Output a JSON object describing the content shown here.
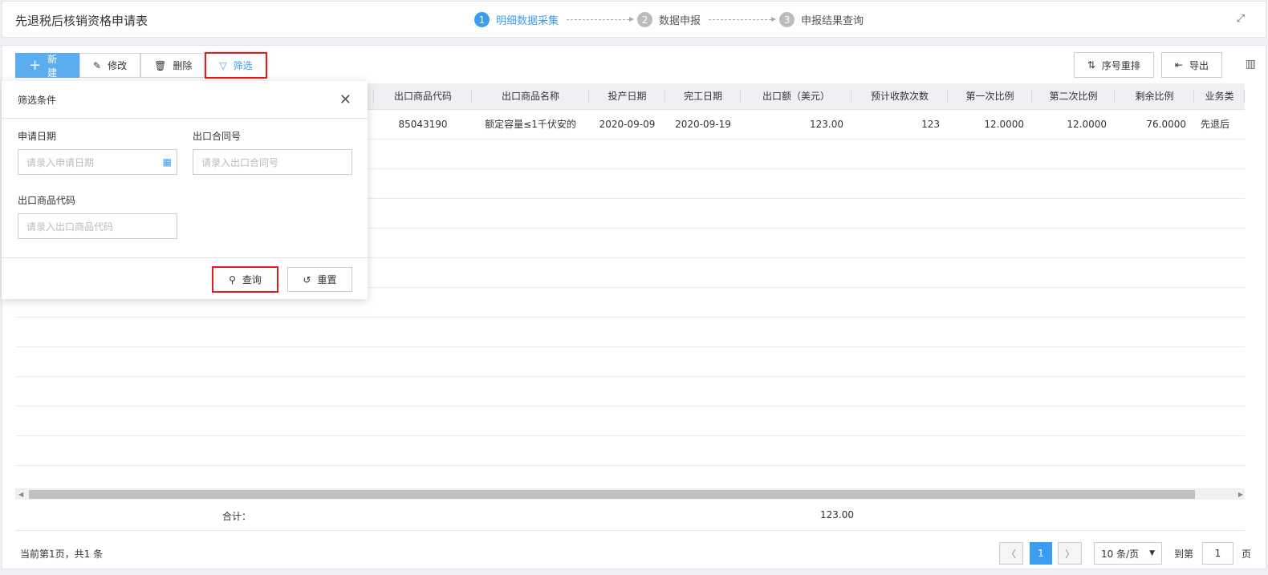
{
  "header": {
    "title": "先退税后核销资格申请表",
    "steps": [
      {
        "num": "1",
        "label": "明细数据采集"
      },
      {
        "num": "2",
        "label": "数据申报"
      },
      {
        "num": "3",
        "label": "申报结果查询"
      }
    ],
    "fullscreen_icon": "expand-icon"
  },
  "toolbar": {
    "new": "新建",
    "edit": "修改",
    "delete": "删除",
    "filter": "筛选",
    "reorder": "序号重排",
    "export": "导出"
  },
  "table": {
    "columns": [
      "出口商品代码",
      "出口商品名称",
      "投产日期",
      "完工日期",
      "出口额（美元）",
      "预计收款次数",
      "第一次比例",
      "第二次比例",
      "剩余比例",
      "业务类"
    ],
    "rows": [
      [
        "85043190",
        "额定容量≤1千伏安的",
        "2020-09-09",
        "2020-09-19",
        "123.00",
        "123",
        "12.0000",
        "12.0000",
        "76.0000",
        "先退后"
      ]
    ],
    "total_label": "合计：",
    "total_value": "123.00"
  },
  "pagination": {
    "info": "当前第1页，共1 条",
    "current": "1",
    "page_size": "10 条/页",
    "goto_label": "到第",
    "goto_value": "1",
    "page_suffix": "页"
  },
  "filter": {
    "title": "筛选条件",
    "fields": [
      {
        "label": "申请日期",
        "placeholder": "请录入申请日期"
      },
      {
        "label": "出口合同号",
        "placeholder": "请录入出口合同号"
      },
      {
        "label": "出口商品代码",
        "placeholder": "请录入出口商品代码"
      }
    ],
    "query": "查询",
    "reset": "重置"
  }
}
